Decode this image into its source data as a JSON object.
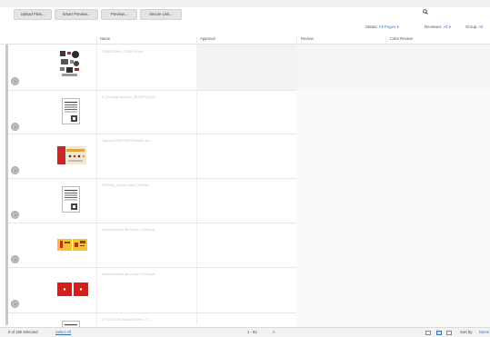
{
  "toolbar": {
    "upload": "Upload Files...",
    "smart_preview": "Smart Preview...",
    "preview": "Preview...",
    "secure_link": "Secure Link..."
  },
  "search": {
    "placeholder": ""
  },
  "filters": {
    "status_label": "Status:",
    "status_value": "All Pages",
    "reviewer_label": "Reviewer:",
    "reviewer_value": "All",
    "group_label": "Group:",
    "group_value": "All"
  },
  "columns": {
    "name": "Name",
    "approval": "Approval",
    "review": "Review",
    "color_review": "Color Review"
  },
  "rows": [
    {
      "filename": "07883733800_07DDP(3).pdf",
      "thumb": "collage"
    },
    {
      "filename": "C_El codigo del buzo_88-38PP(c).pdf",
      "thumb": "document"
    },
    {
      "filename": "Tapa de 07883733878 Bolsillo de...",
      "thumb": "red-cover"
    },
    {
      "filename": "PRENSA_Bolsillo_baño_018488...",
      "thumb": "document"
    },
    {
      "filename": "Some memoria del Campo I 2020.pdf",
      "thumb": "yellow-spread"
    },
    {
      "filename": "Some memoria del Campo I 2020.pdf",
      "thumb": "red-spread"
    },
    {
      "filename": "07733373.08 Vida del Duelo I - E...",
      "thumb": "document"
    }
  ],
  "statusbar": {
    "selected": "0 of 180 Selected",
    "select_all": "Select All",
    "range": "1 - 92",
    "next": ">",
    "sort_label": "Sort by:",
    "sort_value": "Name"
  }
}
